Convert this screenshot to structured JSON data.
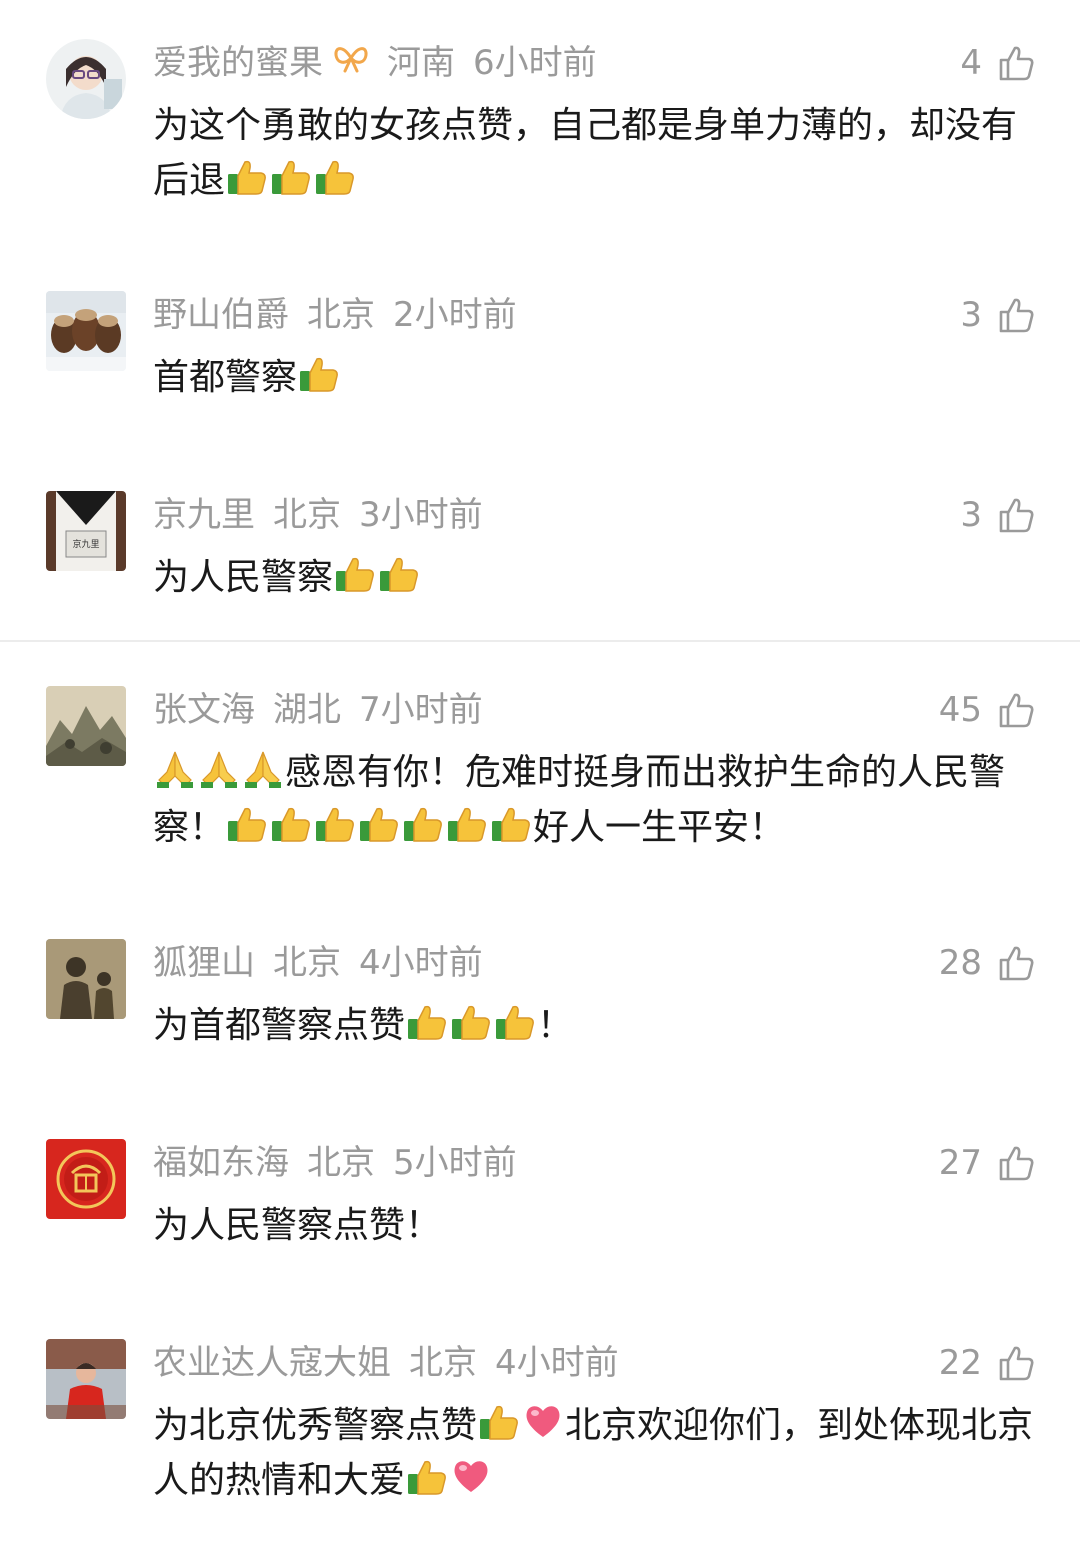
{
  "colors": {
    "meta": "#9a9a9a",
    "text": "#1a1a1a",
    "thumb": "#f6c33a",
    "heart": "#f05a7e"
  },
  "comments": [
    {
      "user": "爱我的蜜果",
      "badge_icon": "bow-icon",
      "location": "河南",
      "time": "6小时前",
      "likes": "4",
      "text_a": "为这个勇敢的女孩点赞，自己都是身单力薄的，却没有后退",
      "thumbs_a": 3
    },
    {
      "user": "野山伯爵",
      "location": "北京",
      "time": "2小时前",
      "likes": "3",
      "text_a": "首都警察",
      "thumbs_a": 1
    },
    {
      "user": "京九里",
      "location": "北京",
      "time": "3小时前",
      "likes": "3",
      "text_a": "为人民警察",
      "thumbs_a": 2
    },
    {
      "user": "张文海",
      "location": "湖北",
      "time": "7小时前",
      "likes": "45",
      "prays": 3,
      "text_a": "感恩有你！危难时挺身而出救护生命的人民警察！",
      "thumbs_a": 7,
      "text_b": "好人一生平安！"
    },
    {
      "user": "狐狸山",
      "location": "北京",
      "time": "4小时前",
      "likes": "28",
      "text_a": "为首都警察点赞",
      "thumbs_a": 3,
      "text_b": "！"
    },
    {
      "user": "福如东海",
      "location": "北京",
      "time": "5小时前",
      "likes": "27",
      "text_a": "为人民警察点赞！"
    },
    {
      "user": "农业达人寇大姐",
      "location": "北京",
      "time": "4小时前",
      "likes": "22",
      "text_a": "为北京优秀警察点赞",
      "thumbs_a": 1,
      "heart_a": 1,
      "text_b": "北京欢迎你们，到处体现北京人的热情和大爱",
      "thumbs_b": 1,
      "heart_b": 1
    }
  ]
}
